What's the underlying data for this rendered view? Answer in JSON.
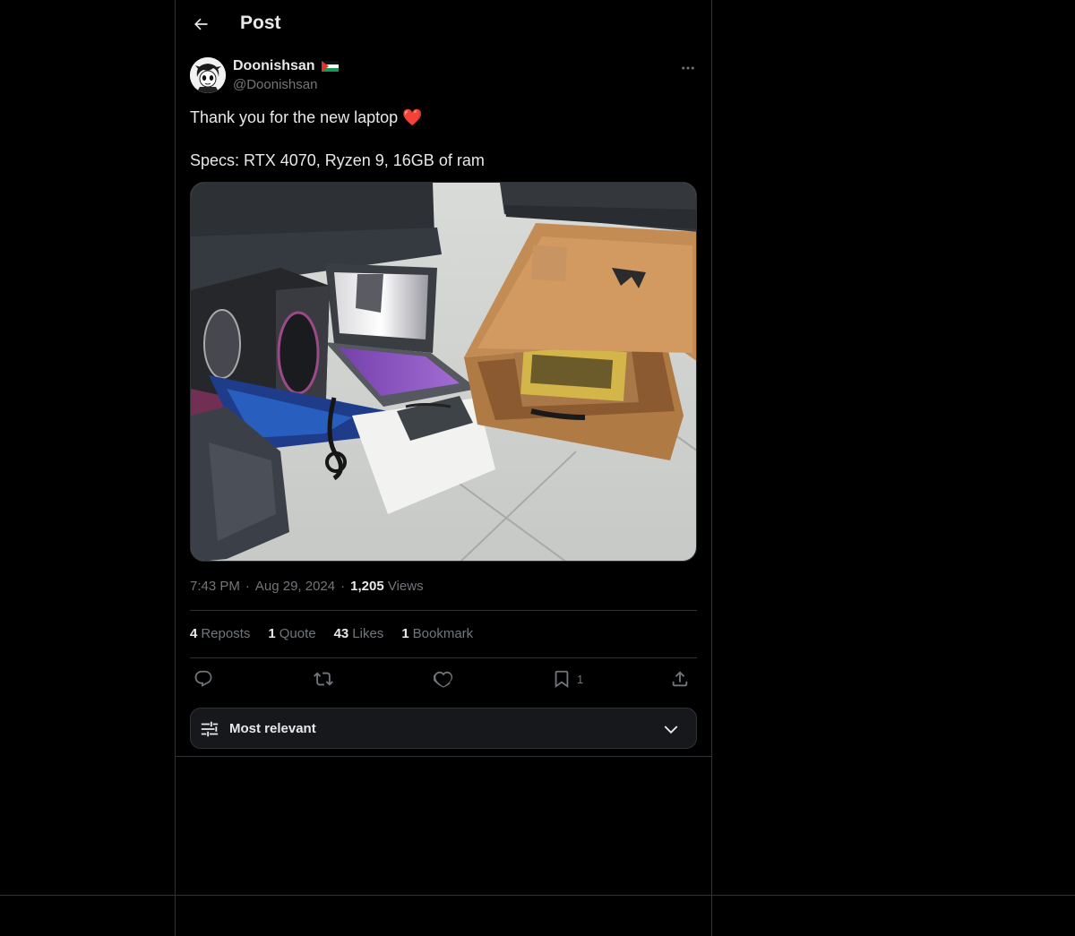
{
  "header": {
    "title": "Post"
  },
  "author": {
    "display_name": "Doonishsan",
    "handle": "@Doonishsan"
  },
  "post": {
    "line1": "Thank you for the new laptop ❤️",
    "line2": "Specs: RTX 4070, Ryzen 9, 16GB of ram"
  },
  "meta": {
    "time": "7:43 PM",
    "date": "Aug 29, 2024",
    "views_count": "1,205",
    "views_label": "Views",
    "separator": "·"
  },
  "stats": {
    "reposts": {
      "count": "4",
      "label": "Reposts"
    },
    "quotes": {
      "count": "1",
      "label": "Quote"
    },
    "likes": {
      "count": "43",
      "label": "Likes"
    },
    "bookmarks": {
      "count": "1",
      "label": "Bookmark"
    }
  },
  "actions": {
    "bookmark_count": "1"
  },
  "sort": {
    "label": "Most relevant"
  },
  "icons": {
    "back": "arrow-left-icon",
    "more": "more-horizontal-icon",
    "flag": "palestine-flag-icon",
    "reply": "reply-icon",
    "repost": "repost-icon",
    "like": "heart-icon",
    "bookmark": "bookmark-icon",
    "share": "share-icon",
    "sort": "sliders-icon",
    "chevron": "chevron-down-icon"
  },
  "colors": {
    "background": "#000000",
    "text": "#e7e9ea",
    "muted": "#71767b",
    "border": "#2f3336"
  }
}
